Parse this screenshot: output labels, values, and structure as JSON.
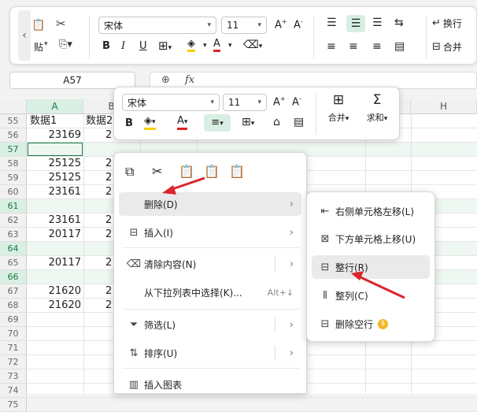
{
  "ribbon": {
    "paste_label": "贴",
    "font_name": "宋体",
    "font_size": "11",
    "wrap_label": "换行",
    "merge_label": "合并"
  },
  "formula_bar": {
    "cell_ref": "A57",
    "fx_label": "fx"
  },
  "grid": {
    "columns": [
      "A",
      "B",
      "H"
    ],
    "rows": [
      "55",
      "56",
      "57",
      "58",
      "59",
      "60",
      "61",
      "62",
      "63",
      "64",
      "65",
      "66",
      "67",
      "68",
      "69",
      "70",
      "71",
      "72",
      "73",
      "74",
      "75"
    ],
    "highlighted_rows": [
      "57",
      "61",
      "64",
      "66"
    ],
    "col_a": [
      "数据1",
      "23169",
      "",
      "25125",
      "25125",
      "23161",
      "",
      "23161",
      "20117",
      "",
      "20117",
      "",
      "21620",
      "21620"
    ],
    "col_b": [
      "数据2",
      "2",
      "",
      "2",
      "2",
      "2",
      "",
      "2",
      "2",
      "",
      "2",
      "",
      "2",
      "2"
    ]
  },
  "mini_toolbar": {
    "font_name": "宋体",
    "font_size": "11",
    "merge_label": "合并",
    "sum_label": "求和"
  },
  "context_menu": {
    "items": [
      {
        "label": "删除(D)",
        "icon": "delete-icon",
        "submenu": true
      },
      {
        "label": "插入(I)",
        "icon": "insert-icon",
        "submenu": true
      },
      {
        "label": "清除内容(N)",
        "icon": "eraser-icon",
        "submenu": true
      },
      {
        "label": "从下拉列表中选择(K)...",
        "shortcut": "Alt+↓"
      },
      {
        "label": "筛选(L)",
        "icon": "filter-icon",
        "submenu": true
      },
      {
        "label": "排序(U)",
        "icon": "sort-icon",
        "submenu": true
      },
      {
        "label": "插入图表",
        "icon": "chart-icon"
      }
    ]
  },
  "delete_submenu": {
    "items": [
      {
        "label": "右侧单元格左移(L)",
        "icon": "shift-left-icon"
      },
      {
        "label": "下方单元格上移(U)",
        "icon": "shift-up-icon"
      },
      {
        "label": "整行(R)",
        "icon": "entire-row-icon"
      },
      {
        "label": "整列(C)",
        "icon": "entire-column-icon"
      },
      {
        "label": "删除空行",
        "icon": "delete-empty-rows-icon"
      }
    ]
  },
  "colors": {
    "accent_green": "#1a7a46",
    "arrow_red": "#d9262c",
    "font_color_red": "#e02020",
    "highlight_yellow": "#f5d000"
  }
}
